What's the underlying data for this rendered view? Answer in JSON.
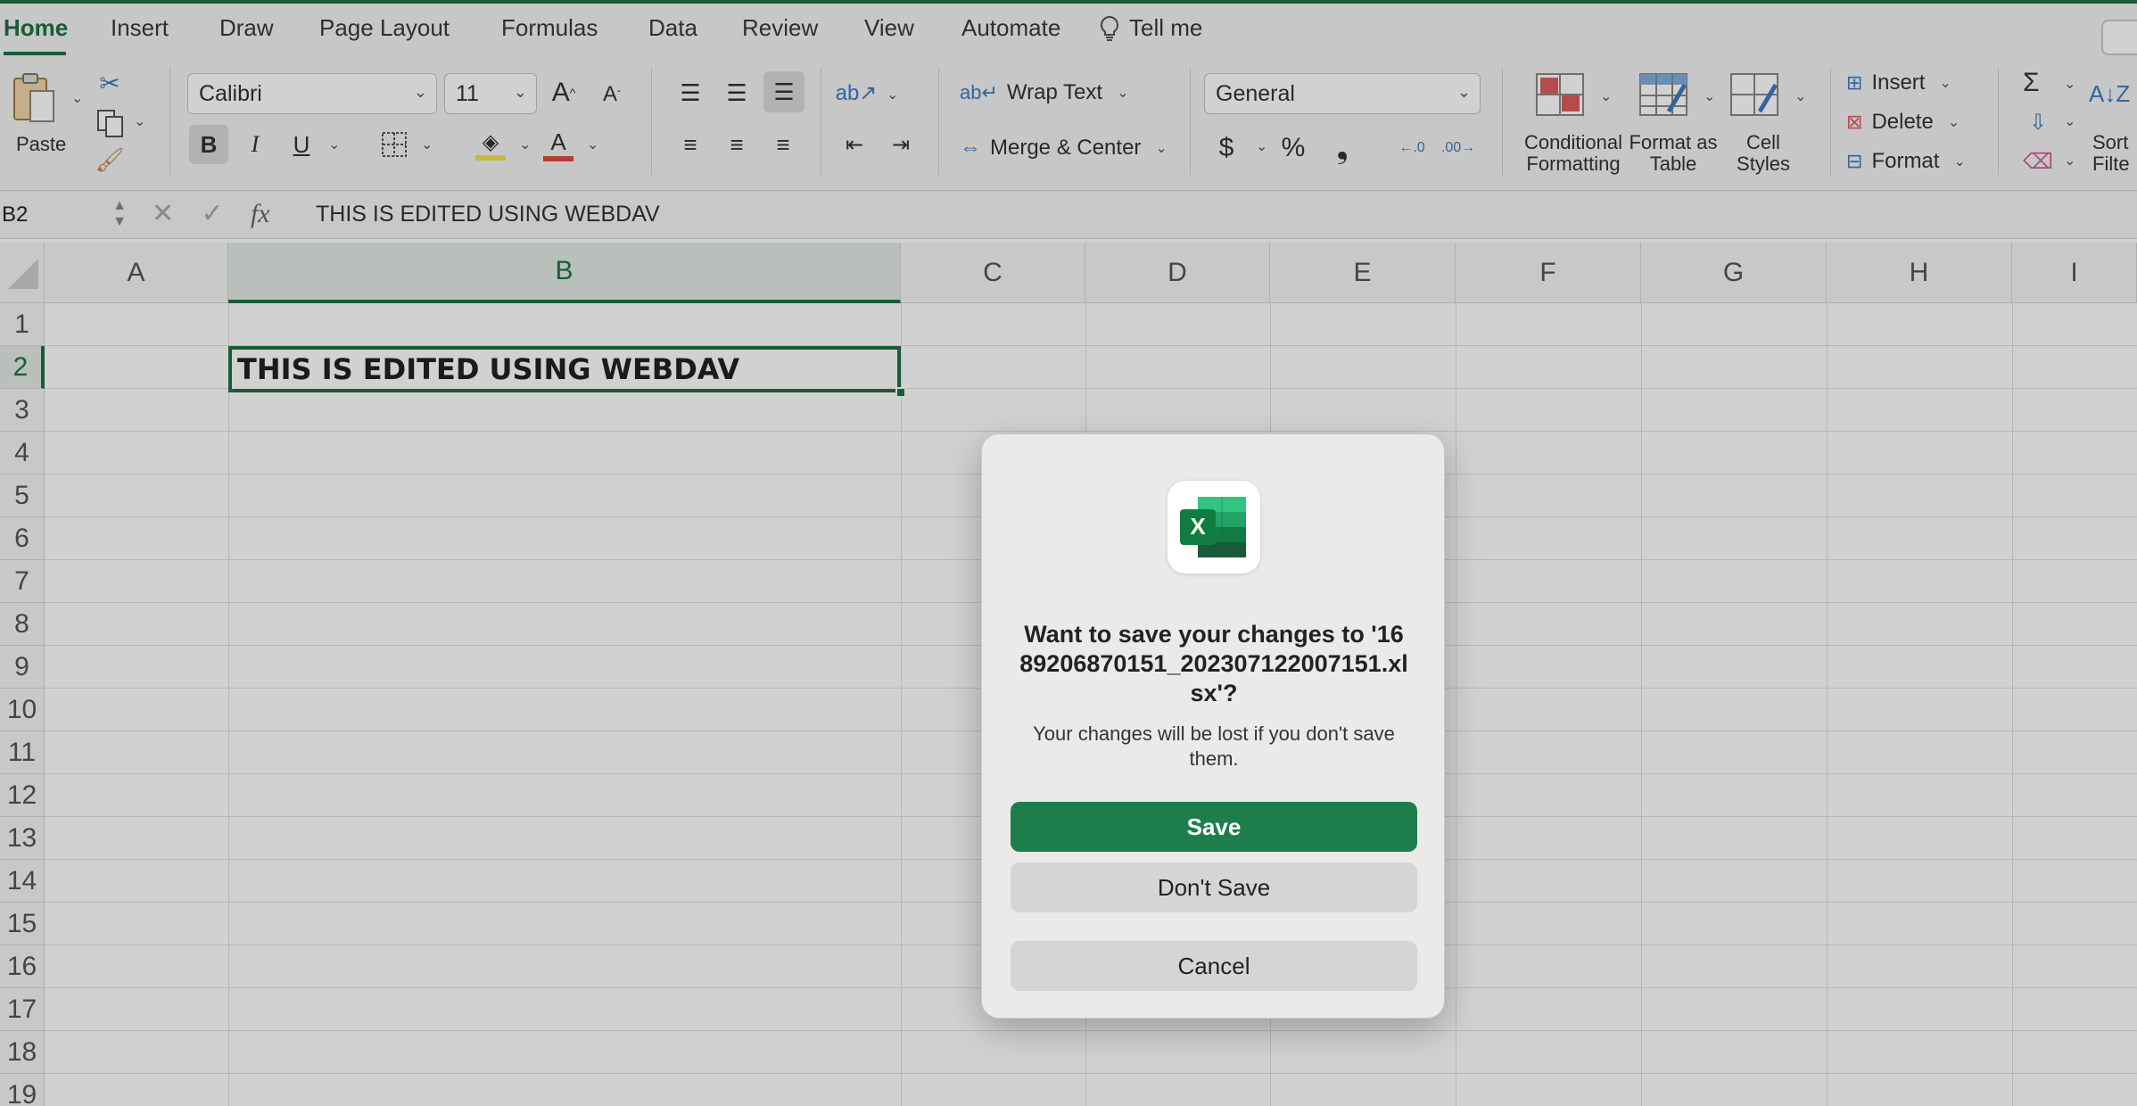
{
  "ribbon_tabs": [
    "Home",
    "Insert",
    "Draw",
    "Page Layout",
    "Formulas",
    "Data",
    "Review",
    "View",
    "Automate"
  ],
  "tell_me": "Tell me",
  "clipboard": {
    "paste": "Paste"
  },
  "font": {
    "name": "Calibri",
    "size": "11",
    "bold": "B",
    "italic": "I",
    "underline": "U"
  },
  "alignment": {
    "wrap_text": "Wrap Text",
    "merge_center": "Merge & Center"
  },
  "number": {
    "format": "General",
    "currency": "$",
    "percent": "%",
    "comma": "❟",
    "inc_decimal": ".0 .00",
    "dec_decimal": ".00 .0"
  },
  "styles": {
    "conditional": "Conditional Formatting",
    "format_table": "Format as Table",
    "cell_styles": "Cell Styles"
  },
  "cells": {
    "insert": "Insert",
    "delete": "Delete",
    "format": "Format"
  },
  "editing": {
    "sort_filter": "Sort Filte",
    "sum_icon": "Σ"
  },
  "formula_bar": {
    "name_box": "B2",
    "fx": "fx",
    "value": "THIS IS EDITED USING WEBDAV"
  },
  "grid": {
    "columns": [
      "A",
      "B",
      "C",
      "D",
      "E",
      "F",
      "G",
      "H",
      "I"
    ],
    "rows": [
      "1",
      "2",
      "3",
      "4",
      "5",
      "6",
      "7",
      "8",
      "9",
      "10",
      "11",
      "12",
      "13",
      "14",
      "15",
      "16",
      "17",
      "18",
      "19"
    ],
    "selected_column": "B",
    "selected_row": "2",
    "cell_b2": "THIS IS EDITED USING WEBDAV"
  },
  "dialog": {
    "title": "Want to save your changes to '1689206870151_202307122007151.xlsx'?",
    "message": "Your changes will be lost if you don't save them.",
    "save": "Save",
    "dont_save": "Don't Save",
    "cancel": "Cancel",
    "icon": "excel-app-icon"
  },
  "colors": {
    "accent": "#1e7145",
    "primary_button": "#1e7e4b"
  }
}
